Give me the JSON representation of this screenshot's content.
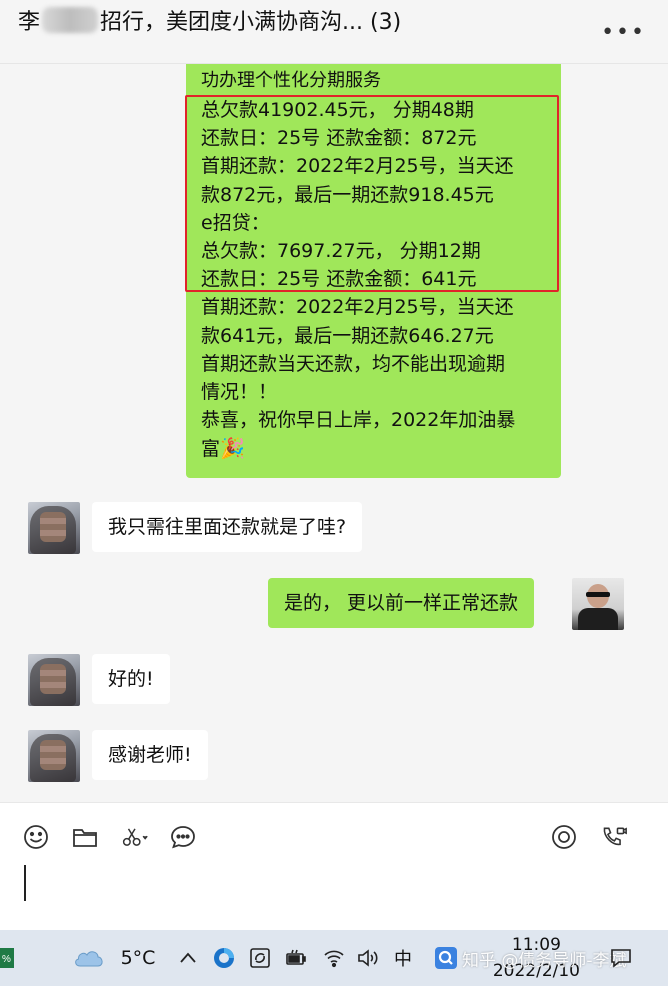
{
  "header": {
    "title_prefix": "李",
    "title_rest": "招行，美团度小满协商沟... (3)",
    "more_label": "..."
  },
  "messages": {
    "big_bubble_lines": [
      "功办理个性化分期服务",
      "总欠款41902.45元， 分期48期",
      "还款日：25号      还款金额：872元",
      "首期还款：2022年2月25号，当天还",
      "款872元，最后一期还款918.45元",
      "e招贷：",
      "总欠款：7697.27元，    分期12期",
      "还款日：25号       还款金额：641元",
      "首期还款：2022年2月25号，当天还",
      "款641元，最后一期还款646.27元",
      "首期还款当天还款，均不能出现逾期",
      "情况！！",
      "恭喜，祝你早日上岸，2022年加油暴",
      "富"
    ],
    "q1": "我只需往里面还款就是了哇?",
    "a1": "是的， 更以前一样正常还款",
    "q2": "好的!",
    "q3": "感谢老师!"
  },
  "taskbar": {
    "temperature": "5°C",
    "ime": "中",
    "time": "11:09",
    "date": "2022/2/10",
    "watermark": "知乎 @债务导师-李斌"
  },
  "colors": {
    "bubble_green": "#a0e75a",
    "highlight_red": "#e0242a"
  }
}
